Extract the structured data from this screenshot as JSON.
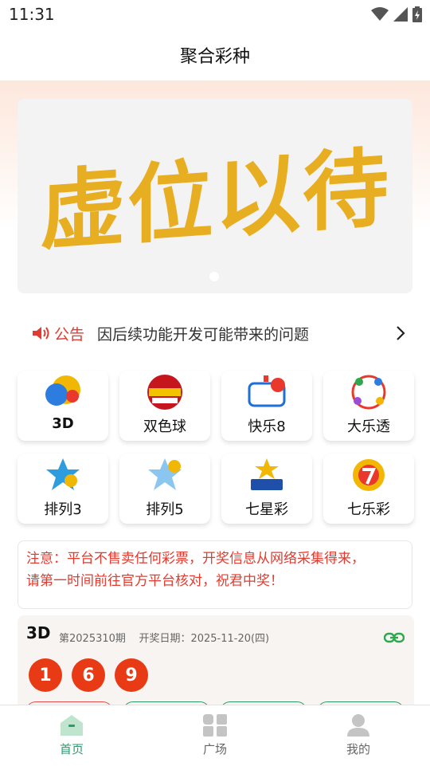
{
  "status_bar": {
    "time": "11:31"
  },
  "header": {
    "title": "聚合彩种"
  },
  "banner": {
    "text": "虚位以待"
  },
  "notice": {
    "tag": "公告",
    "text": "因后续功能开发可能带来的问题"
  },
  "lotteries": [
    {
      "label": "3D",
      "icon": "3d-logo-icon"
    },
    {
      "label": "双色球",
      "icon": "union-lotto-logo-icon"
    },
    {
      "label": "快乐8",
      "icon": "happy8-logo-icon"
    },
    {
      "label": "大乐透",
      "icon": "super-lotto-logo-icon"
    },
    {
      "label": "排列3",
      "icon": "pick3-logo-icon"
    },
    {
      "label": "排列5",
      "icon": "pick5-logo-icon"
    },
    {
      "label": "七星彩",
      "icon": "seven-star-logo-icon"
    },
    {
      "label": "七乐彩",
      "icon": "seven-happy-logo-icon"
    }
  ],
  "warning": {
    "line1": "注意：平台不售卖任何彩票，开奖信息从网络采集得来，",
    "line2": "请第一时间前往官方平台核对，祝君中奖！"
  },
  "result_card": {
    "name": "3D",
    "issue": "第2025310期",
    "draw_date": "开奖日期：2025-11-20(四)",
    "numbers": [
      "1",
      "6",
      "9"
    ]
  },
  "tabs": [
    {
      "label": "首页",
      "active": true
    },
    {
      "label": "广场",
      "active": false
    },
    {
      "label": "我的",
      "active": false
    }
  ],
  "colors": {
    "accent": "#2e9b6c",
    "red": "#e33b2f",
    "ball": "#e83a14",
    "banner_text": "#e8ae22"
  }
}
